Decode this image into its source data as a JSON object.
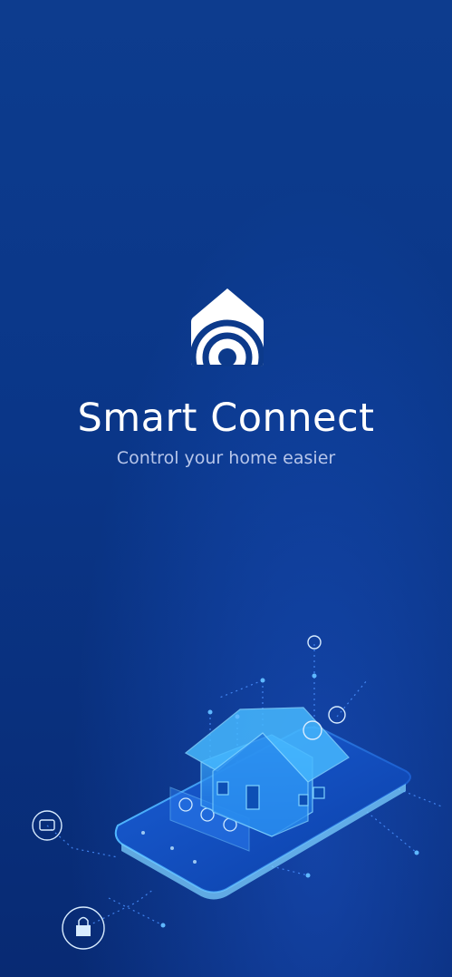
{
  "app": {
    "title": "Smart Connect",
    "tagline": "Control your home easier"
  },
  "icons": {
    "logo": "smart-home-wifi-icon",
    "illustration": "smart-home-phone-illustration"
  },
  "colors": {
    "background_top": "#0d3c8e",
    "background_bottom": "#082a73",
    "title": "#ffffff",
    "subtitle": "#b7c6ea",
    "accent": "#3fa3ff"
  }
}
